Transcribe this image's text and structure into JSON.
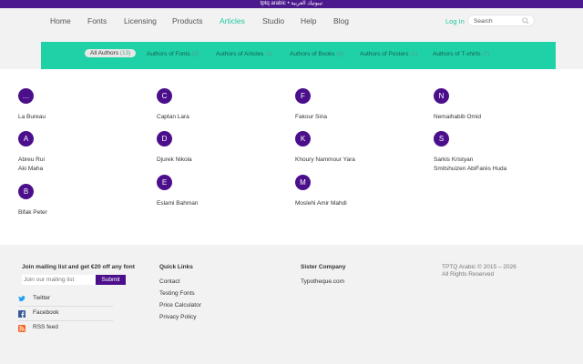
{
  "topbar": {
    "text": "tptq arabic • تيبوتيك العربية"
  },
  "nav": [
    {
      "label": "Home"
    },
    {
      "label": "Fonts"
    },
    {
      "label": "Licensing"
    },
    {
      "label": "Products"
    },
    {
      "label": "Articles"
    },
    {
      "label": "Studio"
    },
    {
      "label": "Help"
    },
    {
      "label": "Blog"
    }
  ],
  "nav_active": "Articles",
  "login_label": "Log In",
  "search": {
    "placeholder": "Search"
  },
  "subnav": [
    {
      "label": "All Authors",
      "count": "(13)"
    },
    {
      "label": "Authors of Fonts",
      "count": "(3)"
    },
    {
      "label": "Authors of Articles",
      "count": "(1)"
    },
    {
      "label": "Authors of Books",
      "count": "(3)"
    },
    {
      "label": "Authors of Posters",
      "count": "(1)"
    },
    {
      "label": "Authors of T-shirts",
      "count": "(7)"
    }
  ],
  "groups": [
    {
      "letter": "…",
      "authors": [
        "La Bureau"
      ]
    },
    {
      "letter": "A",
      "authors": [
        "Abreu Rui",
        "Aki Maha"
      ]
    },
    {
      "letter": "B",
      "authors": [
        "Bifak Peter"
      ]
    },
    {
      "letter": "C",
      "authors": [
        "Captan Lara"
      ]
    },
    {
      "letter": "D",
      "authors": [
        "Djurek Nikola"
      ]
    },
    {
      "letter": "E",
      "authors": [
        "Eslami Bahman"
      ]
    },
    {
      "letter": "F",
      "authors": [
        "Fakour Sina"
      ]
    },
    {
      "letter": "K",
      "authors": [
        "Khoury Nammour Yara"
      ]
    },
    {
      "letter": "M",
      "authors": [
        "Moslehi Amir Mahdi"
      ]
    },
    {
      "letter": "N",
      "authors": [
        "Nemaihabib Omid"
      ]
    },
    {
      "letter": "S",
      "authors": [
        "Sarkis Kristyan",
        "Smitshuizen AbiFarès Huda"
      ]
    }
  ],
  "footer": {
    "mailing_heading": "Join mailing list and get €20 off any font",
    "mailing_placeholder": "Join our mailing list",
    "submit_label": "Submit",
    "social": [
      {
        "label": "Twitter"
      },
      {
        "label": "Facebook"
      },
      {
        "label": "RSS feed"
      }
    ],
    "quick_links_heading": "Quick Links",
    "quick_links": [
      "Contact",
      "Testing Fonts",
      "Price Calculator",
      "Privacy Policy"
    ],
    "sister_heading": "Sister Company",
    "sister_link": "Typotheque.com",
    "copyright": "TPTQ Arabic © 2015 – 2026",
    "rights": "All Rights Reserved"
  },
  "colors": {
    "brand": "#4b0f8c",
    "accent": "#1ed1a6"
  }
}
